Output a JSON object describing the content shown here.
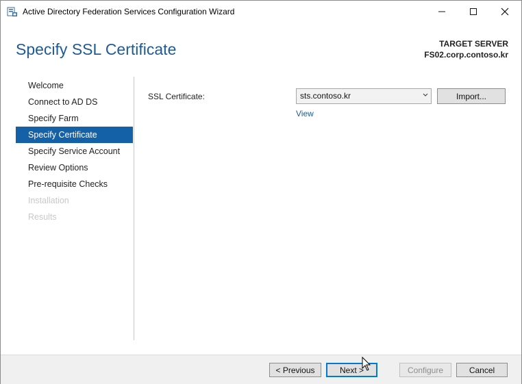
{
  "window": {
    "title": "Active Directory Federation Services Configuration Wizard",
    "app_icon": "adfs-wizard-icon",
    "controls": [
      "minimize-icon",
      "maximize-icon",
      "close-icon"
    ]
  },
  "header": {
    "page_title": "Specify SSL Certificate",
    "target_label": "TARGET SERVER",
    "target_server": "FS02.corp.contoso.kr"
  },
  "nav": {
    "items": [
      {
        "label": "Welcome",
        "state": "normal"
      },
      {
        "label": "Connect to AD DS",
        "state": "normal"
      },
      {
        "label": "Specify Farm",
        "state": "normal"
      },
      {
        "label": "Specify Certificate",
        "state": "active"
      },
      {
        "label": "Specify Service Account",
        "state": "normal"
      },
      {
        "label": "Review Options",
        "state": "normal"
      },
      {
        "label": "Pre-requisite Checks",
        "state": "normal"
      },
      {
        "label": "Installation",
        "state": "disabled"
      },
      {
        "label": "Results",
        "state": "disabled"
      }
    ]
  },
  "main": {
    "ssl_label": "SSL Certificate:",
    "ssl_value": "sts.contoso.kr",
    "import_label": "Import...",
    "view_label": "View"
  },
  "footer": {
    "previous_label": "< Previous",
    "next_label": "Next >",
    "configure_label": "Configure",
    "cancel_label": "Cancel"
  },
  "colors": {
    "accent": "#1461a8",
    "title_blue": "#1e5b97",
    "disabled_text": "#c8c8c8"
  }
}
